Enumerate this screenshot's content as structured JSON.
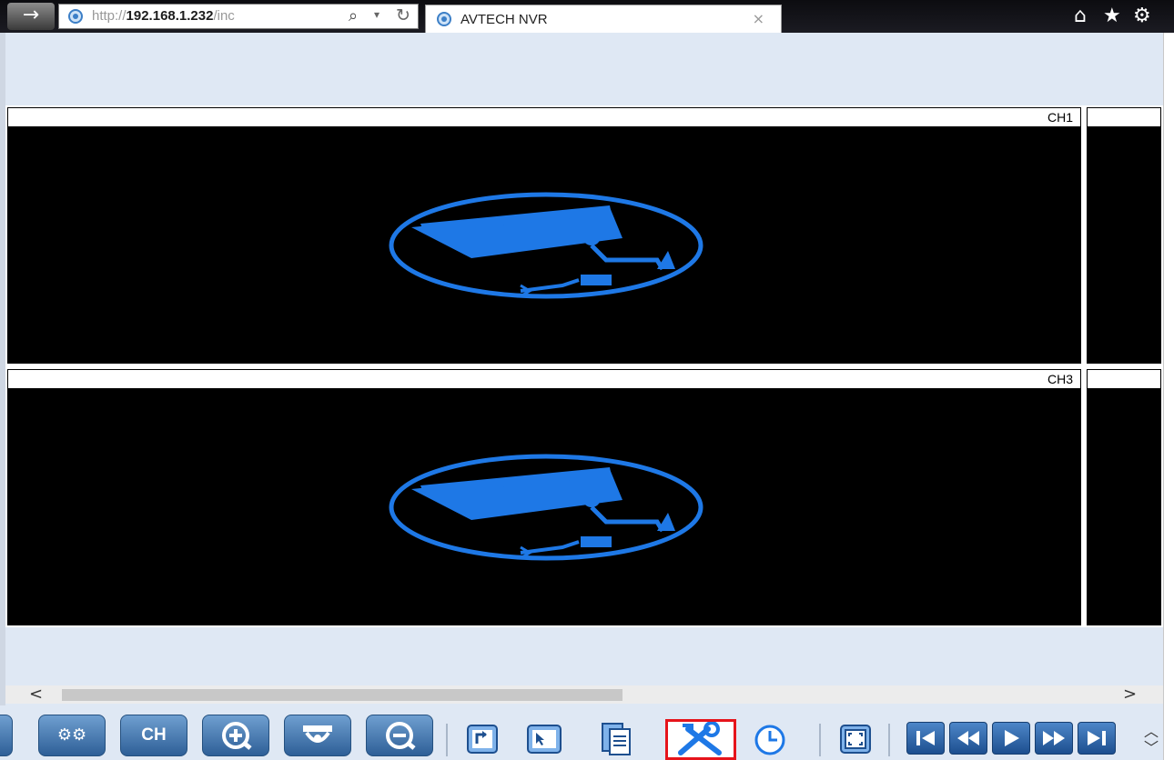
{
  "browser": {
    "back_glyph": "→",
    "address": {
      "prefix": "http://",
      "host": "192.168.1.232",
      "rest": "/inc"
    },
    "address_icons": {
      "search": "search-icon",
      "dropdown": "chevron-down-icon",
      "refresh": "refresh-icon"
    },
    "tab": {
      "title": "AVTECH NVR",
      "close_glyph": "×"
    },
    "right_icons": [
      "home-icon",
      "favorites-star-icon",
      "settings-gear-icon"
    ]
  },
  "viewer": {
    "channels": [
      {
        "label": "CH1",
        "has_video": false
      },
      {
        "label": "",
        "has_video": false
      },
      {
        "label": "CH3",
        "has_video": false
      },
      {
        "label": "",
        "has_video": false
      }
    ],
    "placeholder_icon": "security-camera-icon",
    "icon_color": "#1e78e6"
  },
  "hscroll": {
    "left_glyph": "<",
    "right_glyph": ">"
  },
  "toolbar": {
    "ch_label": "CH",
    "buttons": [
      "settings-gears-icon",
      "channel-button",
      "zoom-in-icon",
      "dome-camera-icon",
      "zoom-out-icon",
      "snapshot-arrow-icon",
      "cursor-screen-icon",
      "documents-icon",
      "tools-icon",
      "clock-icon",
      "fullscreen-icon",
      "skip-to-start-icon",
      "rewind-icon",
      "play-icon",
      "fast-forward-icon",
      "skip-to-end-icon"
    ],
    "highlighted": "tools-icon",
    "highlight_color": "#e6141b",
    "button_color": "#2e5f97"
  }
}
